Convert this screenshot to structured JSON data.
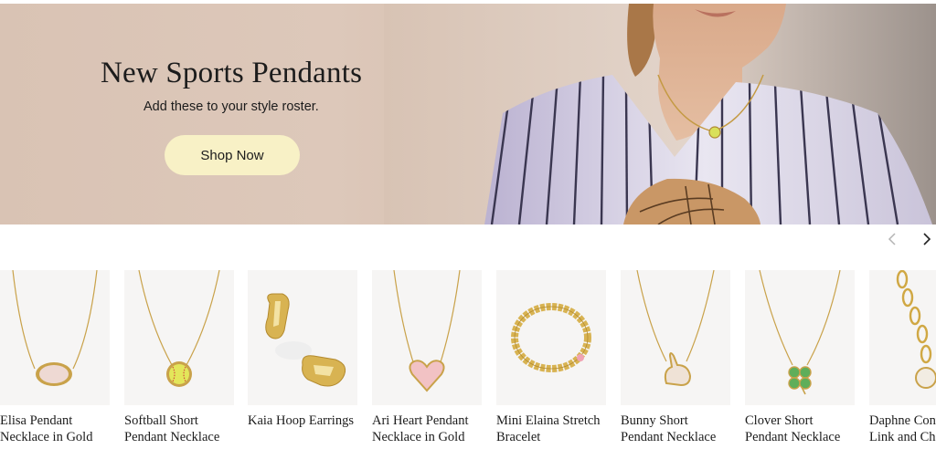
{
  "hero": {
    "title": "New Sports Pendants",
    "subtitle": "Add these to your style roster.",
    "cta_label": "Shop Now",
    "colors": {
      "background": "#dcc6b7",
      "cta_background": "#f8f1c6"
    }
  },
  "carousel": {
    "prev_icon": "chevron-left-icon",
    "next_icon": "chevron-right-icon"
  },
  "products": [
    {
      "name": "Elisa Pendant\nNecklace in Gold",
      "icon": "oval-pendant-necklace"
    },
    {
      "name": "Softball Short\nPendant Necklace",
      "icon": "softball-pendant-necklace"
    },
    {
      "name": "Kaia Hoop Earrings",
      "icon": "hoop-earrings"
    },
    {
      "name": "Ari Heart Pendant\nNecklace in Gold",
      "icon": "heart-pendant-necklace"
    },
    {
      "name": "Mini Elaina Stretch\nBracelet",
      "icon": "beaded-bracelet"
    },
    {
      "name": "Bunny Short\nPendant Necklace",
      "icon": "bunny-pendant-necklace"
    },
    {
      "name": "Clover Short\nPendant Necklace",
      "icon": "clover-pendant-necklace"
    },
    {
      "name": "Daphne Convertible\nLink and Chain",
      "icon": "link-chain-necklace"
    }
  ]
}
